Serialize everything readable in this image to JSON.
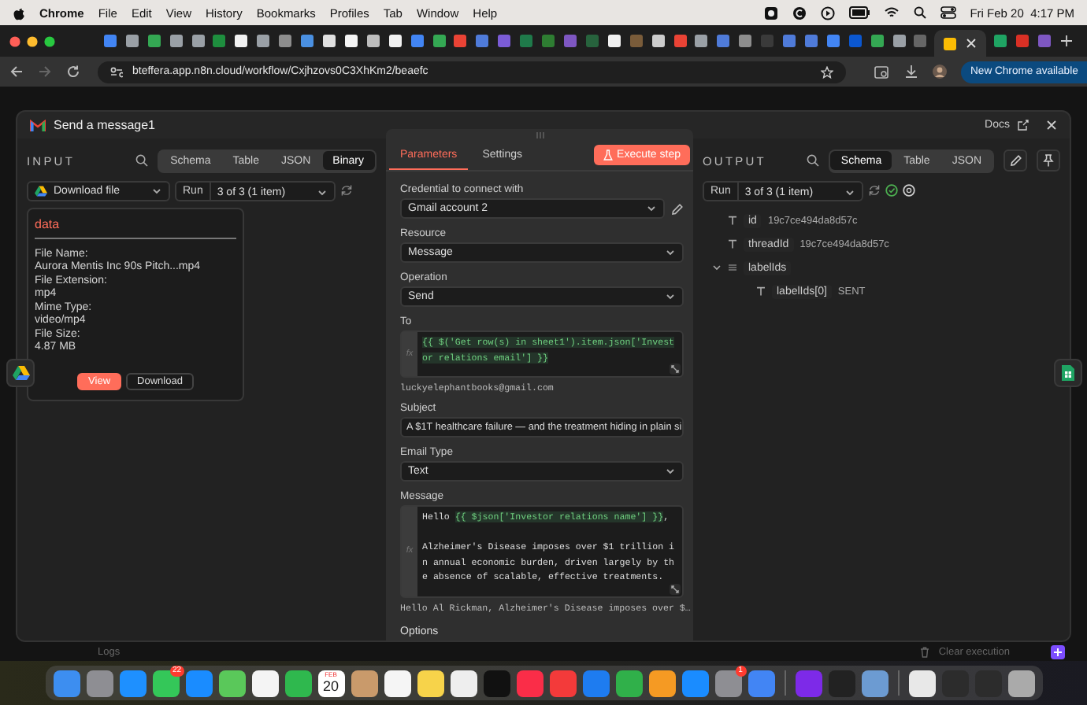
{
  "menubar": {
    "app": "Chrome",
    "menus": [
      "File",
      "Edit",
      "View",
      "History",
      "Bookmarks",
      "Profiles",
      "Tab",
      "Window",
      "Help"
    ],
    "clock": "Fri Feb 20  4:17 PM"
  },
  "browser": {
    "tabs": [
      {
        "color": "#4285f4",
        "selected": false
      },
      {
        "color": "#9aa0a6",
        "selected": false
      },
      {
        "color": "#34a853",
        "selected": false
      },
      {
        "color": "#9aa0a6",
        "selected": false
      },
      {
        "color": "#9aa0a6",
        "selected": false
      },
      {
        "color": "#1e8e3e",
        "selected": false
      },
      {
        "color": "#f1f1f1",
        "selected": false
      },
      {
        "color": "#9aa0a6",
        "selected": false
      },
      {
        "color": "#8d8d8d",
        "selected": false
      },
      {
        "color": "#4a90e2",
        "selected": false
      },
      {
        "color": "#e0e0e0",
        "selected": false
      },
      {
        "color": "#f5f5f5",
        "selected": false
      },
      {
        "color": "#bdbdbd",
        "selected": false
      },
      {
        "color": "#f1f1f1",
        "selected": false
      },
      {
        "color": "#4285f4",
        "selected": false
      },
      {
        "color": "#34a853",
        "selected": false
      },
      {
        "color": "#ea4335",
        "selected": false
      },
      {
        "color": "#4f7bd9",
        "selected": false
      },
      {
        "color": "#7b5cd6",
        "selected": false
      },
      {
        "color": "#1f7a4a",
        "selected": false
      },
      {
        "color": "#2e7d32",
        "selected": false
      },
      {
        "color": "#7e57c2",
        "selected": false
      },
      {
        "color": "#27633d",
        "selected": false
      },
      {
        "color": "#f1f1f1",
        "selected": false
      },
      {
        "color": "#7a5c3a",
        "selected": false
      },
      {
        "color": "#cccccc",
        "selected": false
      },
      {
        "color": "#ea4335",
        "selected": false
      },
      {
        "color": "#9aa0a6",
        "selected": false
      },
      {
        "color": "#4f7bd9",
        "selected": false
      },
      {
        "color": "#8d8d8d",
        "selected": false
      },
      {
        "color": "#3a3a3a",
        "selected": false
      },
      {
        "color": "#4f7bd9",
        "selected": false
      },
      {
        "color": "#4f7bd9",
        "selected": false
      },
      {
        "color": "#4285f4",
        "selected": false
      },
      {
        "color": "#0b57d0",
        "selected": false
      },
      {
        "color": "#34a853",
        "selected": false
      },
      {
        "color": "#9aa0a6",
        "selected": false
      },
      {
        "color": "#666666",
        "selected": false
      },
      {
        "color": "#fbbc04",
        "selected": true
      },
      {
        "color": "#1fa463",
        "selected": false
      },
      {
        "color": "#d93025",
        "selected": false
      },
      {
        "color": "#7e57c2",
        "selected": false
      }
    ],
    "url": "bteffera.app.n8n.cloud/workflow/Cxjhzovs0C3XhKm2/beaefc",
    "update_button": "New Chrome available"
  },
  "modal": {
    "title": "Send a message1",
    "docs": "Docs"
  },
  "input": {
    "heading": "INPUT",
    "view_tabs": [
      {
        "label": "Schema",
        "selected": false
      },
      {
        "label": "Table",
        "selected": false
      },
      {
        "label": "JSON",
        "selected": false
      },
      {
        "label": "Binary",
        "selected": true
      }
    ],
    "source": "Download file",
    "run_label": "Run",
    "run_value": "3 of 3 (1 item)",
    "binary": {
      "name": "data",
      "fields": [
        {
          "label": "File Name:",
          "value": "Aurora Mentis Inc 90s Pitch...mp4"
        },
        {
          "label": "File Extension:",
          "value": "mp4"
        },
        {
          "label": "Mime Type:",
          "value": "video/mp4"
        },
        {
          "label": "File Size:",
          "value": "4.87 MB"
        }
      ],
      "buttons": [
        {
          "label": "View",
          "kind": "primary"
        },
        {
          "label": "Download",
          "kind": "secondary"
        }
      ]
    }
  },
  "parameters": {
    "tabs": [
      {
        "label": "Parameters",
        "selected": true
      },
      {
        "label": "Settings",
        "selected": false
      }
    ],
    "execute_button": "Execute step",
    "fields": [
      {
        "kind": "select",
        "label": "Credential to connect with",
        "value": "Gmail account 2",
        "editable": true
      },
      {
        "kind": "select",
        "label": "Resource",
        "value": "Message",
        "editable": false
      },
      {
        "kind": "select",
        "label": "Operation",
        "value": "Send",
        "editable": false
      },
      {
        "kind": "expression",
        "label": "To",
        "gutter": "fx",
        "segments": [
          {
            "kind": "expression",
            "text": "{{ $('Get row(s) in sheet1').item.json['Investor relations email'] }}"
          }
        ],
        "result": "luckyelephantbooks@gmail.com"
      },
      {
        "kind": "text",
        "label": "Subject",
        "value": "A $1T healthcare failure — and the treatment hiding in plain si"
      },
      {
        "kind": "select",
        "label": "Email Type",
        "value": "Text",
        "editable": false
      },
      {
        "kind": "expression",
        "label": "Message",
        "gutter": "fx",
        "segments": [
          {
            "kind": "plain",
            "text": "Hello "
          },
          {
            "kind": "expression",
            "text": "{{ $json['Investor relations name'] }}"
          },
          {
            "kind": "plain",
            "text": ",\n\nAlzheimer's Disease imposes over $1 trillion in annual economic burden, driven largely by the absence of scalable, effective treatments."
          }
        ],
        "result": "Hello Al Rickman, Alzheimer's Disease imposes over $…"
      }
    ],
    "options_label": "Options"
  },
  "output": {
    "heading": "OUTPUT",
    "view_tabs": [
      {
        "label": "Schema",
        "selected": true
      },
      {
        "label": "Table",
        "selected": false
      },
      {
        "label": "JSON",
        "selected": false
      }
    ],
    "run_label": "Run",
    "run_value": "3 of 3 (1 item)",
    "schema": [
      {
        "kind": "string",
        "key": "id",
        "value": "19c7ce494da8d57c"
      },
      {
        "kind": "string",
        "key": "threadId",
        "value": "19c7ce494da8d57c"
      },
      {
        "kind": "array",
        "key": "labelIds",
        "expanded": true,
        "children": [
          {
            "kind": "string",
            "key": "labelIds[0]",
            "value": "SENT"
          }
        ]
      }
    ]
  },
  "footer": {
    "logs": "Logs",
    "clear": "Clear execution"
  },
  "dock": {
    "apps": [
      {
        "kind": "app",
        "color": "#3d8ef0"
      },
      {
        "kind": "app",
        "color": "#8e8e93"
      },
      {
        "kind": "app",
        "color": "#1e90ff"
      },
      {
        "kind": "app",
        "color": "#34c759",
        "badge": "22"
      },
      {
        "kind": "app",
        "color": "#1a8cff"
      },
      {
        "kind": "app",
        "color": "#5ac85a"
      },
      {
        "kind": "app",
        "color": "#f4f4f4"
      },
      {
        "kind": "app",
        "color": "#2fb84e"
      },
      {
        "kind": "calendar",
        "month": "FEB",
        "day": "20"
      },
      {
        "kind": "app",
        "color": "#c99a6b"
      },
      {
        "kind": "app",
        "color": "#f5f5f5"
      },
      {
        "kind": "app",
        "color": "#f7d34a"
      },
      {
        "kind": "app",
        "color": "#eeeeee"
      },
      {
        "kind": "app",
        "color": "#111111"
      },
      {
        "kind": "app",
        "color": "#fa2d48"
      },
      {
        "kind": "app",
        "color": "#f33a3a"
      },
      {
        "kind": "app",
        "color": "#1e7cf0"
      },
      {
        "kind": "app",
        "color": "#30b04a"
      },
      {
        "kind": "app",
        "color": "#f59a23"
      },
      {
        "kind": "app",
        "color": "#1a8cff"
      },
      {
        "kind": "app",
        "color": "#8e8e93",
        "badge": "1"
      },
      {
        "kind": "app",
        "color": "#4285f4"
      },
      {
        "kind": "separator"
      },
      {
        "kind": "app",
        "color": "#7d2ae8"
      },
      {
        "kind": "app",
        "color": "#222222"
      },
      {
        "kind": "app",
        "color": "#6c9bd2"
      },
      {
        "kind": "separator"
      },
      {
        "kind": "app",
        "color": "#e8e8e8"
      },
      {
        "kind": "app",
        "color": "#2c2c2c"
      },
      {
        "kind": "app",
        "color": "#2c2c2c"
      },
      {
        "kind": "app",
        "color": "#aaaaaa"
      }
    ]
  }
}
